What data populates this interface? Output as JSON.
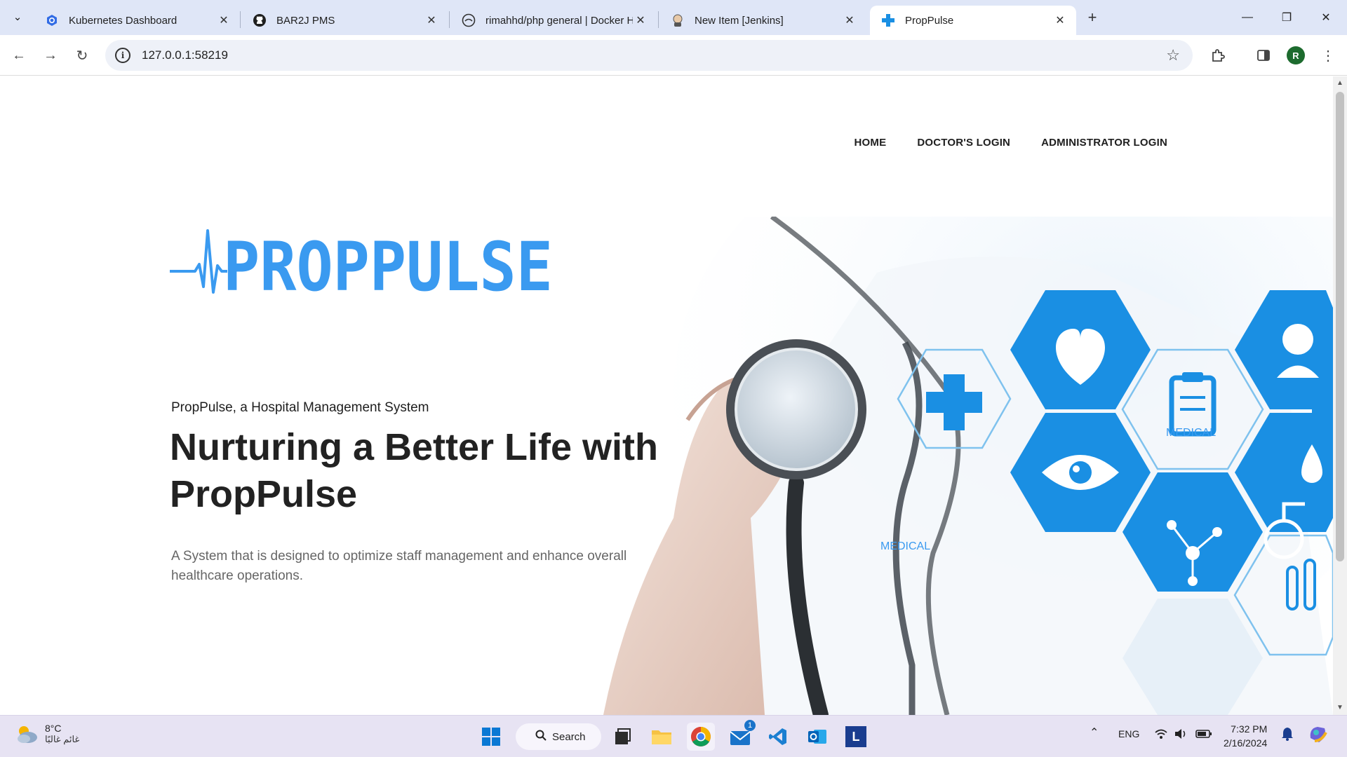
{
  "browser": {
    "tabs": [
      {
        "title": "Kubernetes Dashboard",
        "icon": "kubernetes-icon"
      },
      {
        "title": "BAR2J PMS",
        "icon": "github-icon"
      },
      {
        "title": "rimahhd/php general | Docker H",
        "icon": "docker-icon"
      },
      {
        "title": "New Item [Jenkins]",
        "icon": "jenkins-icon"
      },
      {
        "title": "PropPulse",
        "icon": "medical-cross-icon",
        "active": true
      }
    ],
    "url": "127.0.0.1:58219",
    "profile_initial": "R"
  },
  "site": {
    "nav": [
      "HOME",
      "DOCTOR'S LOGIN",
      "ADMINISTRATOR LOGIN"
    ],
    "logo_text": "PROPPULSE",
    "tagline": "PropPulse, a Hospital Management System",
    "headline": "Nurturing a Better Life with PropPulse",
    "description": "A System that is designed to optimize staff management and enhance overall healthcare operations.",
    "art_labels": [
      "MEDICAL",
      "MEDICAL"
    ],
    "colors": {
      "brand": "#3a9af0",
      "hex_blue": "#1a8fe3"
    }
  },
  "taskbar": {
    "temperature": "8°C",
    "condition": "غائم غالبًا",
    "search_label": "Search",
    "mail_badge": "1",
    "language": "ENG",
    "time": "7:32 PM",
    "date": "2/16/2024",
    "vscode_label": "L"
  }
}
